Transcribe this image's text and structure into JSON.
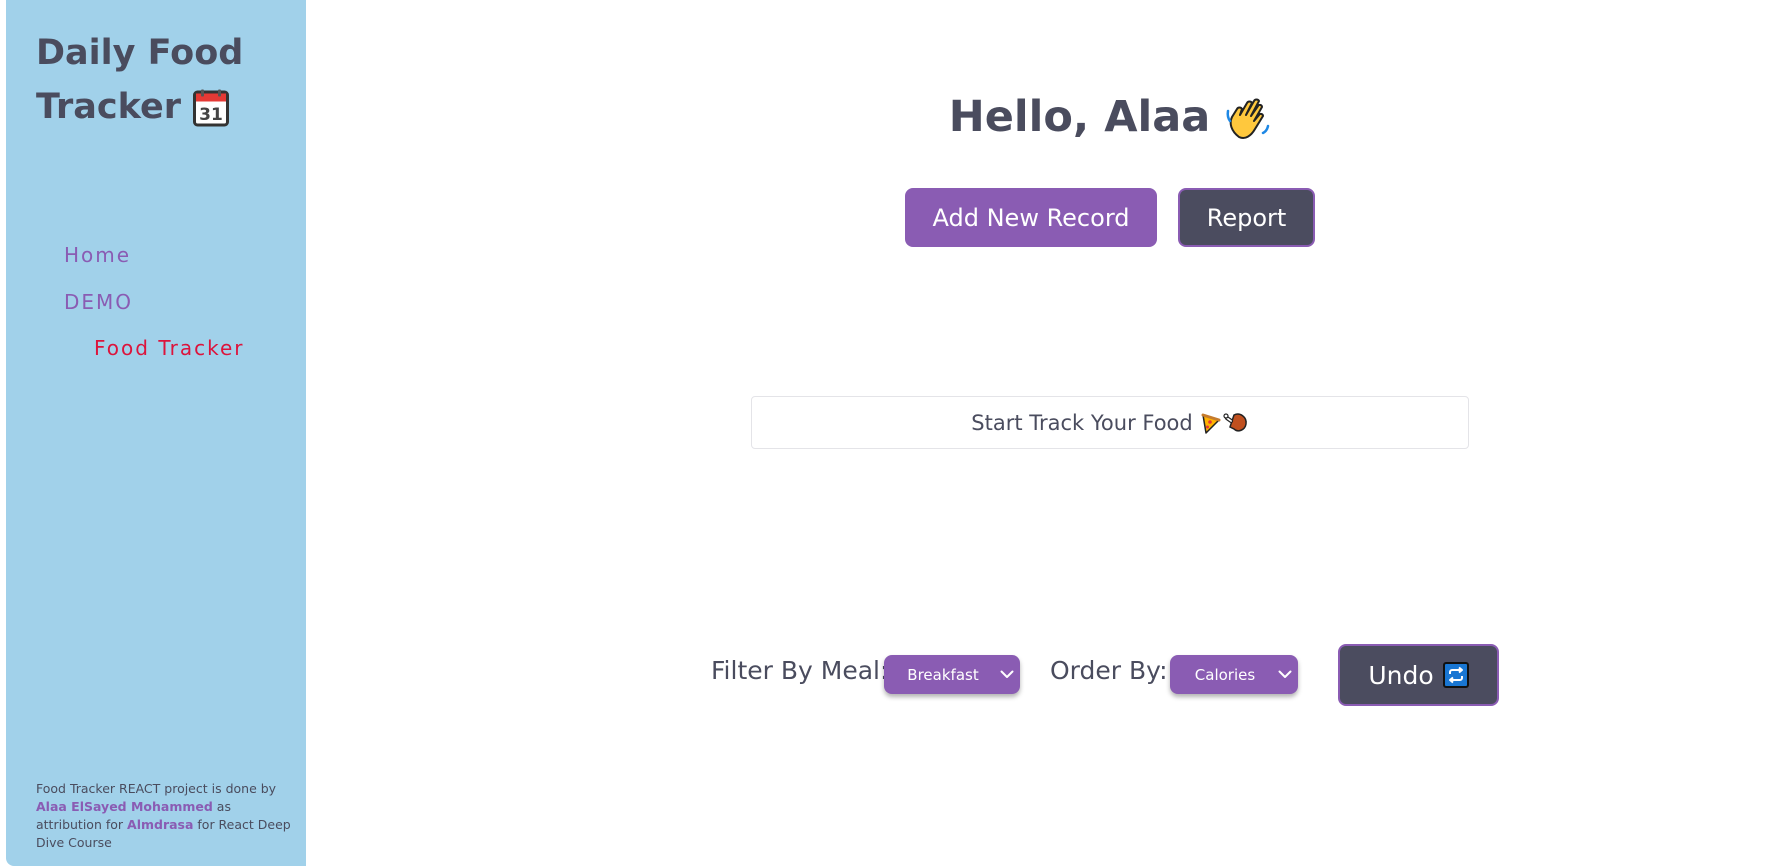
{
  "sidebar": {
    "app_title": "Daily Food Tracker",
    "title_icon": "calendar-icon",
    "nav": {
      "home": "Home",
      "demo": "DEMO",
      "food_tracker": "Food Tracker"
    },
    "footer": {
      "line_start": "Food Tracker REACT project is done by ",
      "author": "Alaa ElSayed Mohammed",
      "middle": " as attribution for ",
      "org": "Almdrasa",
      "line_end": " for React Deep Dive Course"
    }
  },
  "main": {
    "greeting": "Hello, Alaa",
    "greeting_icon": "waving-hand-icon",
    "add_button": "Add New Record",
    "report_button": "Report",
    "empty_message": "Start Track Your Food",
    "empty_icons": [
      "pizza-icon",
      "drumstick-icon"
    ],
    "filter_label": "Filter By Meal:",
    "filter_value": "Breakfast",
    "order_label": "Order By:",
    "order_value": "Calories",
    "undo_button": "Undo",
    "undo_icon": "repeat-icon"
  },
  "colors": {
    "sidebar_bg": "#a1d1ea",
    "accent": "#8a5cb3",
    "dark_button": "#4b4c5f",
    "active_nav": "#dc143c",
    "text": "#4a4c5e"
  }
}
